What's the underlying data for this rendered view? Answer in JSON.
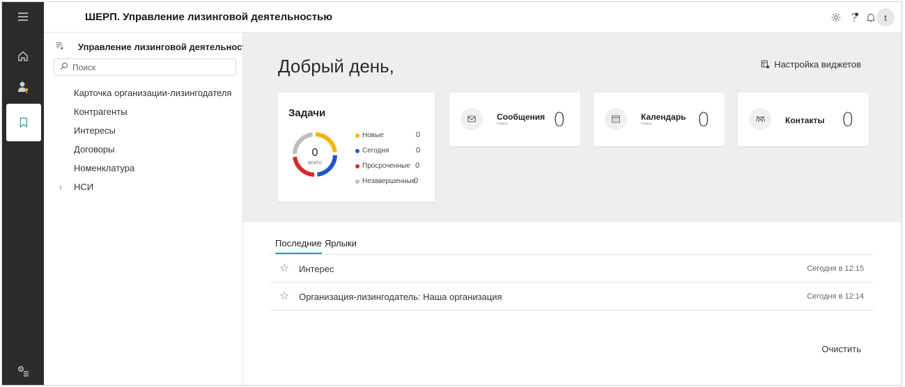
{
  "app": {
    "title": "ШЕРП. Управление лизинговой деятельностью",
    "avatar_letter": "t"
  },
  "rail": {
    "items": [
      {
        "icon": "hamburger-menu-icon"
      },
      {
        "icon": "home-icon"
      },
      {
        "icon": "user-key-icon"
      },
      {
        "icon": "bookmark-icon",
        "active": true
      },
      {
        "icon": "settings-list-icon"
      }
    ]
  },
  "header_icons": [
    "gear-icon",
    "help-notify-icon",
    "bell-icon"
  ],
  "nav": {
    "title": "Управление лизинговой деятельност...",
    "search_placeholder": "Поиск",
    "items": [
      {
        "label": "Карточка организации-лизингодателя"
      },
      {
        "label": "Контрагенты"
      },
      {
        "label": "Интересы"
      },
      {
        "label": "Договоры"
      },
      {
        "label": "Номенклатура"
      },
      {
        "label": "НСИ",
        "expandable": true
      }
    ]
  },
  "dashboard": {
    "greeting": "Добрый день,",
    "widget_settings": "Настройка виджетов",
    "tasks": {
      "title": "Задачи",
      "total": "0",
      "total_label": "всего",
      "legend": [
        {
          "label": "Новые",
          "value": "0",
          "color": "#f2b600"
        },
        {
          "label": "Сегодня",
          "value": "0",
          "color": "#1f57c8"
        },
        {
          "label": "Просроченные",
          "value": "0",
          "color": "#d62b2b"
        },
        {
          "label": "Незавершенные",
          "value": "0",
          "color": "#bdbdbd"
        }
      ]
    },
    "widgets": [
      {
        "label": "Сообщения",
        "sub": "Новые",
        "count": "0",
        "icon": "mail-icon"
      },
      {
        "label": "Календарь",
        "sub": "Новые",
        "count": "0",
        "icon": "calendar-icon"
      },
      {
        "label": "Контакты",
        "sub": "",
        "count": "0",
        "icon": "contacts-icon"
      }
    ]
  },
  "recent": {
    "tabs": [
      "Последние",
      "Ярлыки"
    ],
    "items": [
      {
        "title": "Интерес",
        "time": "Сегодня в 12:15"
      },
      {
        "title": "Организация-лизингодатель: Наша организация",
        "time": "Сегодня в 12:14"
      }
    ],
    "clear_label": "Очистить"
  }
}
